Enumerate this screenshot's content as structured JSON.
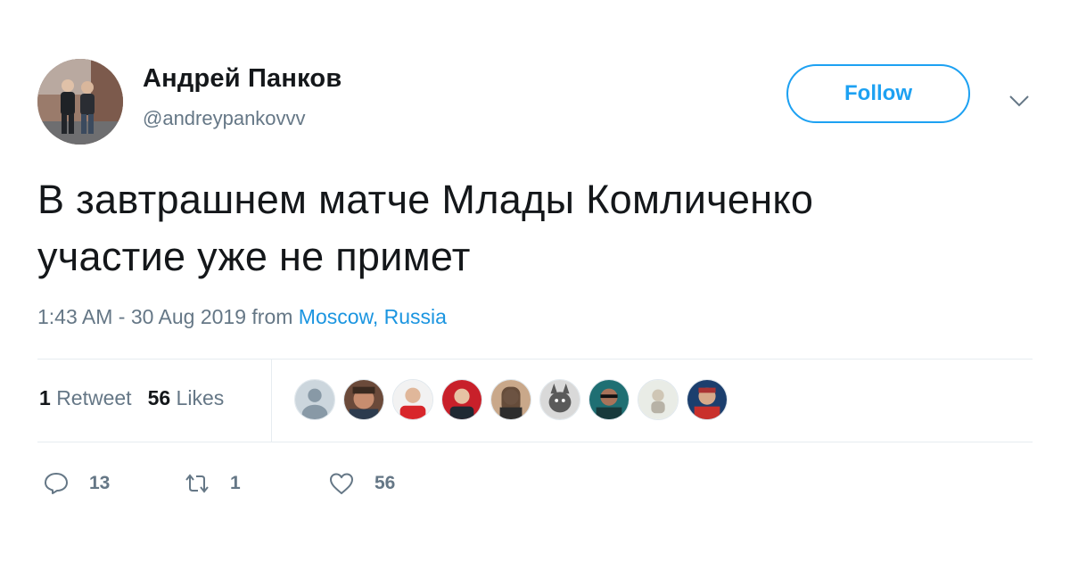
{
  "user": {
    "name": "Андрей Панков",
    "handle": "@andreypankovvv"
  },
  "follow_label": "Follow",
  "tweet": {
    "line1": "В завтрашнем матче Млады Комличенко",
    "line2": "участие уже не примет"
  },
  "meta": {
    "time": "1:43 AM - 30 Aug 2019 from ",
    "location": "Moscow, Russia"
  },
  "stats": {
    "retweets_count": "1",
    "retweets_label": "Retweet",
    "likes_count": "56",
    "likes_label": "Likes"
  },
  "likers": [
    {
      "icon": "default-avatar"
    },
    {
      "icon": "user-avatar"
    },
    {
      "icon": "user-avatar"
    },
    {
      "icon": "user-avatar"
    },
    {
      "icon": "user-avatar"
    },
    {
      "icon": "user-avatar"
    },
    {
      "icon": "user-avatar"
    },
    {
      "icon": "user-avatar"
    },
    {
      "icon": "user-avatar"
    }
  ],
  "actions": {
    "replies": "13",
    "retweets": "1",
    "likes": "56"
  },
  "colors": {
    "accent": "#1da1f2",
    "link": "#1b95e0",
    "muted": "#657786",
    "text": "#14171a"
  }
}
